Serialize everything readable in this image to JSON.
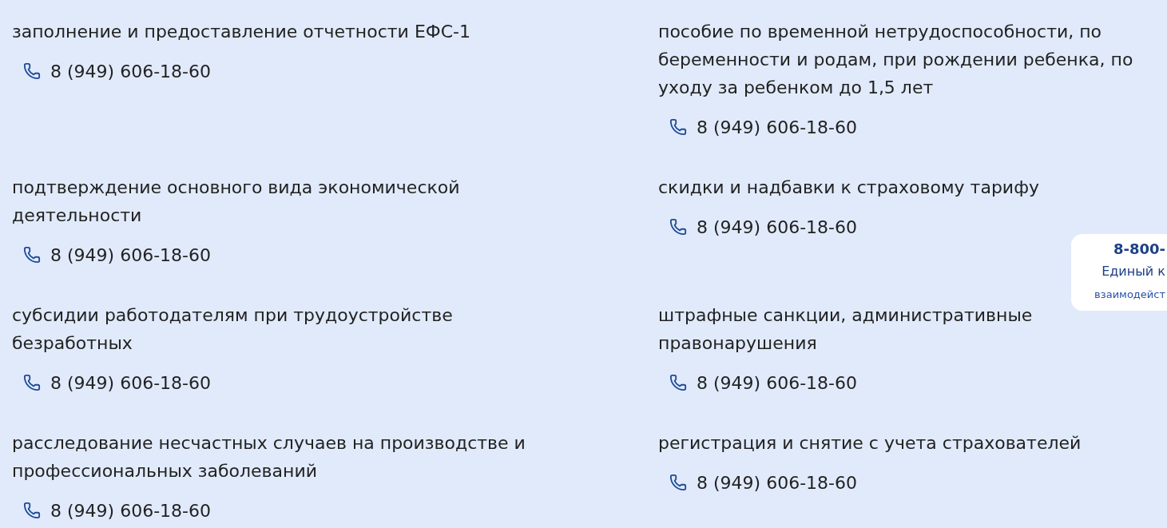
{
  "contacts": [
    {
      "topic": "заполнение и предоставление отчетности ЕФС-1",
      "phone": "8 (949) 606-18-60"
    },
    {
      "topic": "пособие по временной нетрудоспособности, по беременности и родам, при рождении ребенка, по уходу за ребенком до 1,5 лет",
      "phone": "8 (949) 606-18-60"
    },
    {
      "topic": "подтверждение основного вида экономической деятельности",
      "phone": "8 (949) 606-18-60"
    },
    {
      "topic": "скидки и надбавки к страховому тарифу",
      "phone": "8 (949) 606-18-60"
    },
    {
      "topic": "субсидии работодателям при трудоустройстве безработных",
      "phone": "8 (949) 606-18-60"
    },
    {
      "topic": "штрафные санкции, административные правонарушения",
      "phone": "8 (949) 606-18-60"
    },
    {
      "topic": "расследование несчастных случаев на производстве и профессиональных заболеваний",
      "phone": "8 (949) 606-18-60"
    },
    {
      "topic": "регистрация и снятие с учета страхователей",
      "phone": "8 (949) 606-18-60"
    }
  ],
  "help_widget": {
    "phone": "8-800-",
    "title": "Единый к",
    "subtitle": "взаимодейст"
  }
}
